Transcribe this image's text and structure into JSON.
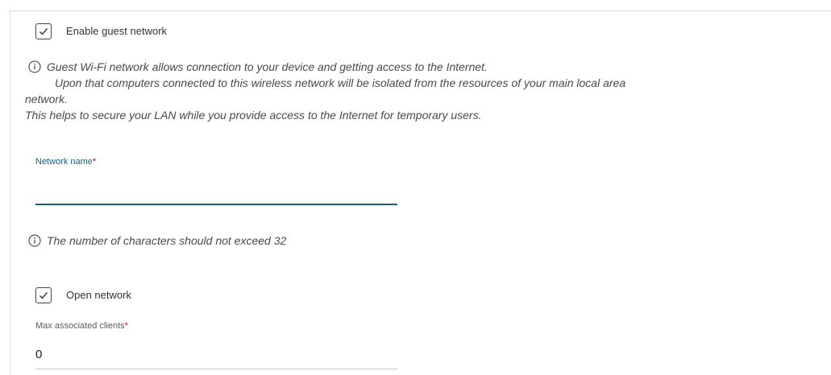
{
  "guest_network": {
    "enable_label": "Enable guest network",
    "enable_checked": true
  },
  "info": {
    "line1": "Guest Wi-Fi network allows connection to your device and getting access to the Internet.",
    "line2": "Upon that computers connected to this wireless network will be isolated from the resources of your main local area",
    "line3": "network.",
    "line4": "This helps to secure your LAN while you provide access to the Internet for temporary users."
  },
  "network_name": {
    "label": "Network name",
    "required_mark": "*",
    "value": "",
    "hint": "The number of characters should not exceed 32"
  },
  "open_network": {
    "label": "Open network",
    "checked": true
  },
  "max_clients": {
    "label": "Max associated clients",
    "required_mark": "*",
    "value": "0"
  },
  "colors": {
    "accent": "#1c5f7a",
    "required": "#d0021b"
  },
  "icons": {
    "checkbox_check": "check-icon",
    "info": "info-icon"
  }
}
